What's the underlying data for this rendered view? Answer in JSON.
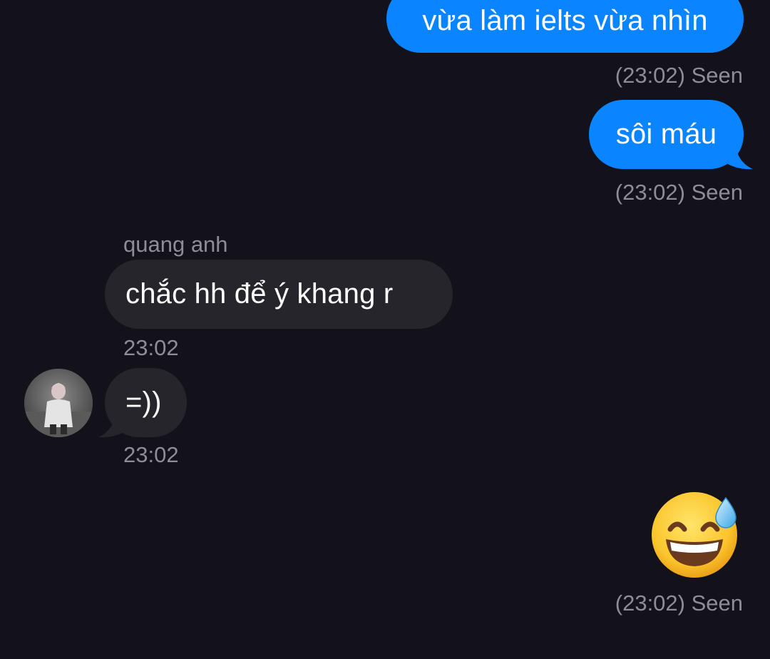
{
  "messages": [
    {
      "id": "m1",
      "direction": "outgoing",
      "text": "vừa làm ielts vừa nhìn",
      "meta": "(23:02) Seen"
    },
    {
      "id": "m2",
      "direction": "outgoing",
      "text": "sôi máu",
      "meta": "(23:02) Seen"
    },
    {
      "id": "m3",
      "direction": "incoming",
      "sender": "quang anh",
      "text": "chắc hh để ý khang r",
      "meta": "23:02"
    },
    {
      "id": "m4",
      "direction": "incoming",
      "text": "=))",
      "meta": "23:02"
    },
    {
      "id": "m5",
      "direction": "outgoing",
      "emoji": "grinning-face-with-sweat",
      "meta": "(23:02) Seen"
    }
  ],
  "colors": {
    "background": "#13111a",
    "outgoing_bubble": "#0a84ff",
    "incoming_bubble": "#26252b",
    "meta_text": "#8e8d96"
  }
}
